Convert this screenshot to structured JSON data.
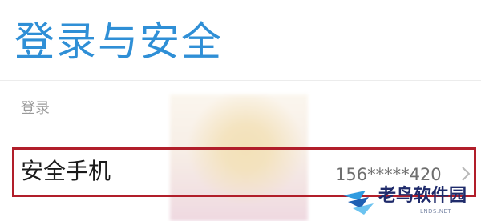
{
  "page": {
    "title": "登录与安全",
    "section_label": "登录"
  },
  "row": {
    "label": "安全手机",
    "value": "156*****420",
    "chevron_icon": "chevron-right-icon"
  },
  "watermark": {
    "text": "老鸟软件园",
    "subtext": "LNDS.NET"
  },
  "colors": {
    "title": "#2f8fd6",
    "highlight_border": "#b11e2a",
    "secondary_text": "#9a9a9a"
  }
}
